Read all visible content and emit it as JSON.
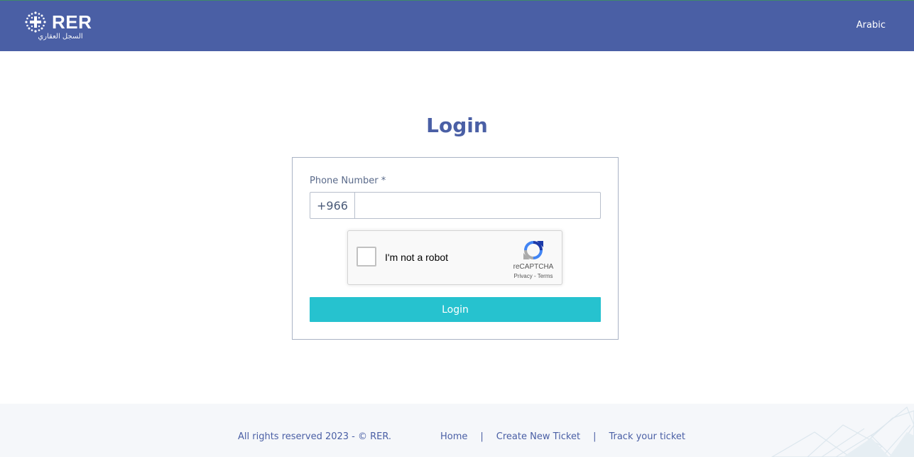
{
  "header": {
    "logo_text": "RER",
    "logo_arabic": "السجل العقاري",
    "language_link": "Arabic"
  },
  "main": {
    "title": "Login",
    "phone": {
      "label": "Phone Number *",
      "prefix": "+966",
      "value": ""
    },
    "recaptcha": {
      "label": "I'm not a robot",
      "brand": "reCAPTCHA",
      "privacy": "Privacy",
      "separator": "-",
      "terms": "Terms"
    },
    "submit_label": "Login"
  },
  "footer": {
    "copyright": "All rights reserved 2023 - © RER.",
    "links": [
      "Home",
      "Create New Ticket",
      "Track your ticket"
    ],
    "separator": "|"
  },
  "colors": {
    "header_bg": "#4a5fa5",
    "accent_text": "#4a5fa5",
    "button_bg": "#26c2cf",
    "footer_bg": "#f5f7fa"
  },
  "icons": [
    "rer-logo-icon",
    "recaptcha-icon",
    "footer-decoration"
  ]
}
